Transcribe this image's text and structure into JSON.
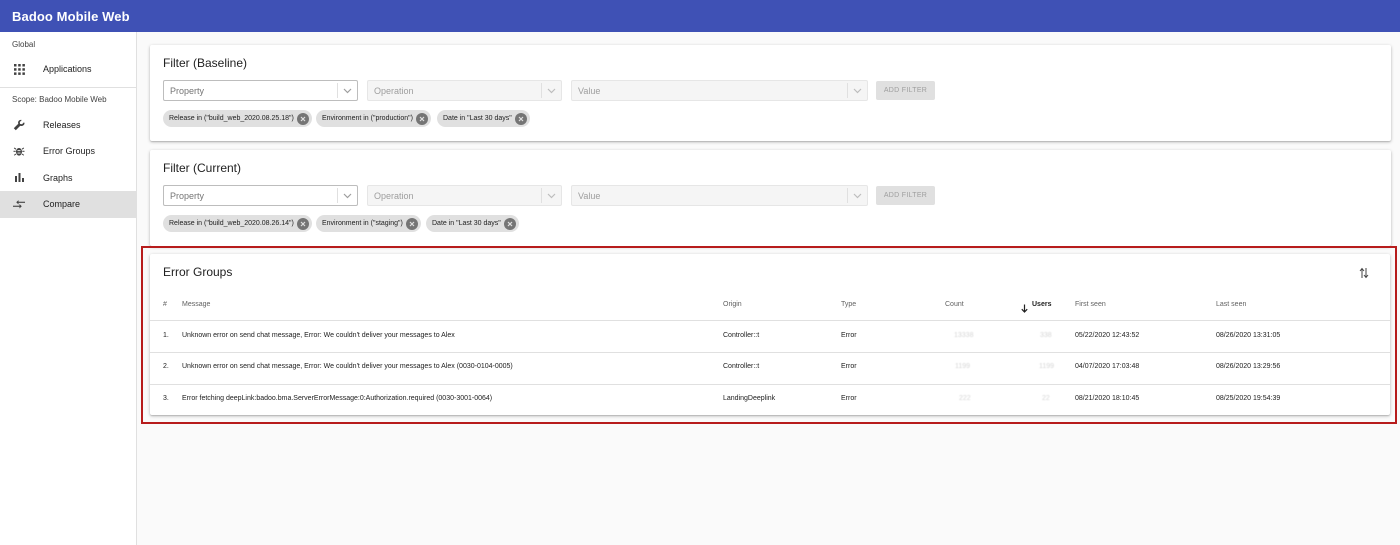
{
  "app": {
    "title": "Badoo Mobile Web"
  },
  "sidebar": {
    "global_label": "Global",
    "items_global": [
      {
        "label": "Applications",
        "icon": "apps-grid-icon"
      }
    ],
    "scope_label": "Scope: Badoo Mobile Web",
    "items_scope": [
      {
        "label": "Releases",
        "icon": "wrench-icon"
      },
      {
        "label": "Error Groups",
        "icon": "bug-icon"
      },
      {
        "label": "Graphs",
        "icon": "bar-chart-icon"
      },
      {
        "label": "Compare",
        "icon": "compare-arrows-icon"
      }
    ],
    "active_item": "Compare"
  },
  "filter_baseline": {
    "title": "Filter (Baseline)",
    "property_placeholder": "Property",
    "operation_placeholder": "Operation",
    "value_placeholder": "Value",
    "add_label": "ADD FILTER",
    "chips": [
      "Release in (\"build_web_2020.08.25.18\")",
      "Environment in (\"production\")",
      "Date in \"Last 30 days\""
    ]
  },
  "filter_current": {
    "title": "Filter (Current)",
    "property_placeholder": "Property",
    "operation_placeholder": "Operation",
    "value_placeholder": "Value",
    "add_label": "ADD FILTER",
    "chips": [
      "Release in (\"build_web_2020.08.26.14\")",
      "Environment in (\"staging\")",
      "Date in \"Last 30 days\""
    ]
  },
  "error_groups": {
    "title": "Error Groups",
    "columns": {
      "num": "#",
      "message": "Message",
      "origin": "Origin",
      "type": "Type",
      "count": "Count",
      "users": "Users",
      "first_seen": "First seen",
      "last_seen": "Last seen"
    },
    "sort_column": "Users",
    "rows": [
      {
        "num": "1.",
        "message": "Unknown error on send chat message, Error: We couldn't deliver your messages to Alex",
        "origin": "Controller::t",
        "type": "Error",
        "count": "13338",
        "users": "338",
        "first_seen": "05/22/2020 12:43:52",
        "last_seen": "08/26/2020 13:31:05"
      },
      {
        "num": "2.",
        "message": "Unknown error on send chat message, Error: We couldn't deliver your messages to Alex (0030-0104-0005)",
        "origin": "Controller::t",
        "type": "Error",
        "count": "1199",
        "users": "1199",
        "first_seen": "04/07/2020 17:03:48",
        "last_seen": "08/26/2020 13:29:56"
      },
      {
        "num": "3.",
        "message": "Error fetching deepLink:badoo.bma.ServerErrorMessage:0:Authorization.required (0030-3001-0064)",
        "origin": "LandingDeeplink",
        "type": "Error",
        "count": "222",
        "users": "22",
        "first_seen": "08/21/2020 18:10:45",
        "last_seen": "08/25/2020 19:54:39"
      }
    ]
  },
  "colors": {
    "appbar": "#3f51b5",
    "highlight_border": "#b71c1c",
    "active_nav": "#e0e0e0"
  }
}
